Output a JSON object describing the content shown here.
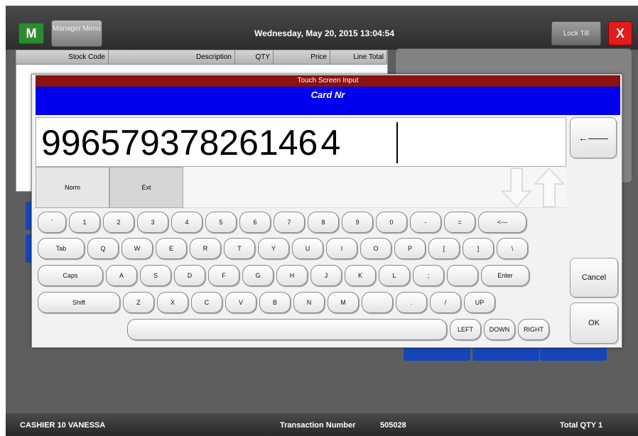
{
  "header": {
    "m_button": "M",
    "manager_menu": "Manager Menu",
    "datetime": "Wednesday, May 20, 2015 13:04:54",
    "lock_till": "Lock Till",
    "close": "X"
  },
  "grid": {
    "columns": [
      "Stock Code",
      "Description",
      "QTY",
      "Price",
      "Line Total"
    ]
  },
  "status": {
    "cashier": "CASHIER 10 VANESSA",
    "transaction_label": "Transaction Number",
    "transaction_number": "505028",
    "total_qty": "Total QTY  1"
  },
  "dialog": {
    "title": "Touch Screen Input",
    "field_label": "Card Nr",
    "value": "99657937826146 4",
    "backspace_top": "←——",
    "tabs": [
      "Norm",
      "Ext"
    ],
    "cancel": "Cancel",
    "ok": "OK",
    "rows": [
      [
        "`",
        "1",
        "2",
        "3",
        "4",
        "5",
        "6",
        "7",
        "8",
        "9",
        "0",
        "-",
        "=",
        "<---"
      ],
      [
        "Tab",
        "Q",
        "W",
        "E",
        "R",
        "T",
        "Y",
        "U",
        "I",
        "O",
        "P",
        "[",
        "]",
        "\\"
      ],
      [
        "Caps",
        "A",
        "S",
        "D",
        "F",
        "G",
        "H",
        "J",
        "K",
        "L",
        ";",
        "",
        "Enter"
      ],
      [
        "Shift",
        "Z",
        "X",
        "C",
        "V",
        "B",
        "N",
        "M",
        "",
        ".",
        "/",
        "UP"
      ],
      [
        "",
        "LEFT",
        "DOWN",
        "RIGHT"
      ]
    ]
  }
}
